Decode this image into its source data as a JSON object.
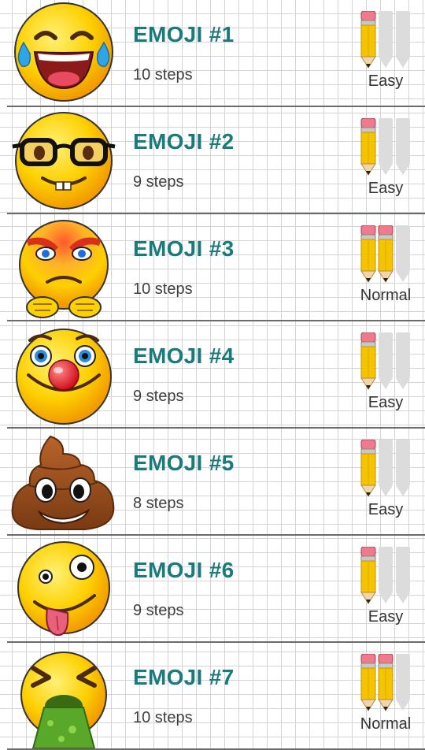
{
  "colors": {
    "title": "#1a7a7c",
    "steps_text": "#404040",
    "divider": "#6b6b6b",
    "pencil_active": "#f5c400",
    "pencil_inactive": "#dcdcdc"
  },
  "difficulty_scale_max": 3,
  "items": [
    {
      "title": "EMOJI #1",
      "steps": "10 steps",
      "difficulty": "Easy",
      "level": 1,
      "icon": "laughing-tears-emoji-icon"
    },
    {
      "title": "EMOJI #2",
      "steps": "9 steps",
      "difficulty": "Easy",
      "level": 1,
      "icon": "nerd-glasses-emoji-icon"
    },
    {
      "title": "EMOJI #3",
      "steps": "10 steps",
      "difficulty": "Normal",
      "level": 2,
      "icon": "angry-fists-emoji-icon"
    },
    {
      "title": "EMOJI #4",
      "steps": "9 steps",
      "difficulty": "Easy",
      "level": 1,
      "icon": "clown-nose-emoji-icon"
    },
    {
      "title": "EMOJI #5",
      "steps": "8 steps",
      "difficulty": "Easy",
      "level": 1,
      "icon": "poop-emoji-icon"
    },
    {
      "title": "EMOJI #6",
      "steps": "9 steps",
      "difficulty": "Easy",
      "level": 1,
      "icon": "crazy-tongue-emoji-icon"
    },
    {
      "title": "EMOJI #7",
      "steps": "10 steps",
      "difficulty": "Normal",
      "level": 2,
      "icon": "vomiting-emoji-icon"
    }
  ]
}
